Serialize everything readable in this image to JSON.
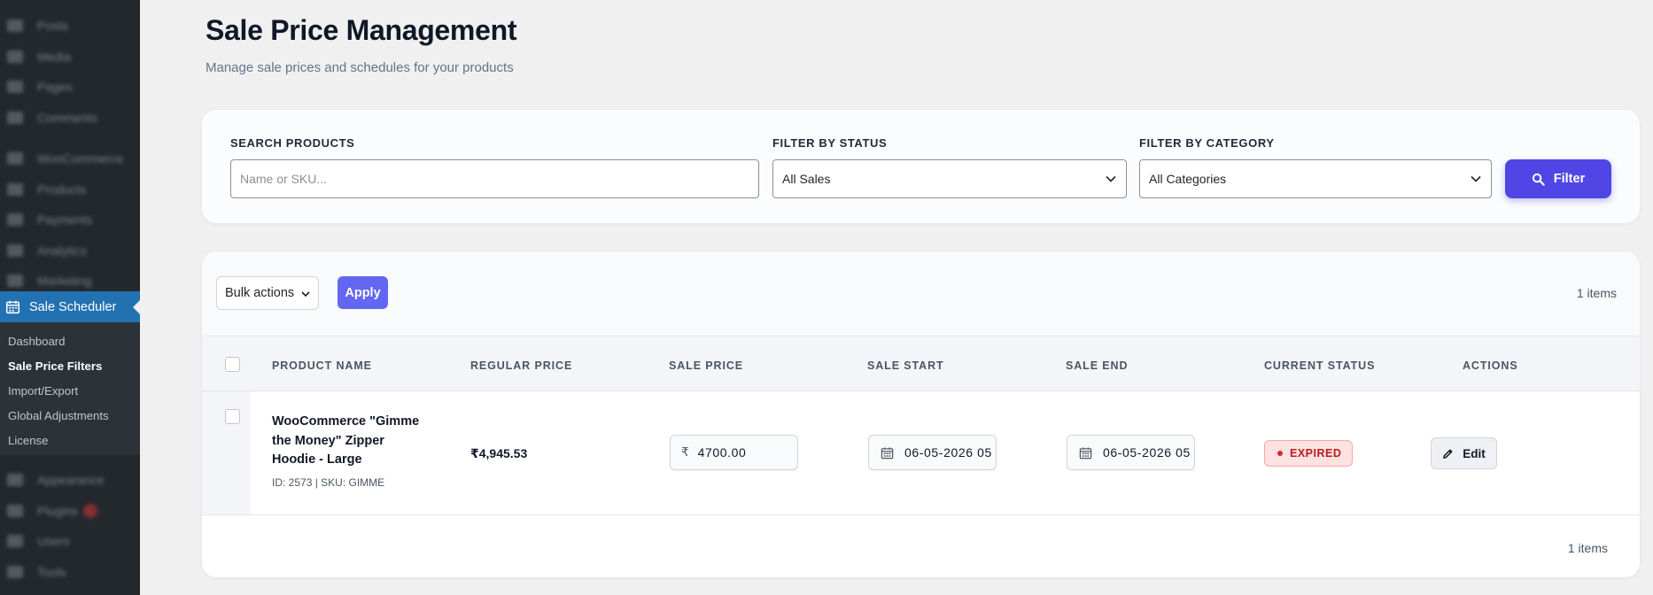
{
  "sidebar": {
    "active_label": "Sale Scheduler",
    "submenu": [
      {
        "label": "Dashboard",
        "current": false
      },
      {
        "label": "Sale Price Filters",
        "current": true
      },
      {
        "label": "Import/Export",
        "current": false
      },
      {
        "label": "Global Adjustments",
        "current": false
      },
      {
        "label": "License",
        "current": false
      }
    ]
  },
  "page": {
    "title": "Sale Price Management",
    "subtitle": "Manage sale prices and schedules for your products"
  },
  "filters": {
    "search_label": "SEARCH PRODUCTS",
    "search_placeholder": "Name or SKU...",
    "status_label": "FILTER BY STATUS",
    "status_value": "All Sales",
    "category_label": "FILTER BY CATEGORY",
    "category_value": "All Categories",
    "filter_button": "Filter"
  },
  "toolbar": {
    "bulk_actions": "Bulk actions",
    "apply": "Apply",
    "items_count": "1 items"
  },
  "table": {
    "columns": [
      "PRODUCT NAME",
      "REGULAR PRICE",
      "SALE PRICE",
      "SALE START",
      "SALE END",
      "CURRENT STATUS",
      "ACTIONS"
    ],
    "rows": [
      {
        "product_name": "WooCommerce \"Gimme the Money\" Zipper Hoodie - Large",
        "meta": "ID: 2573 | SKU: GIMME",
        "regular_price": "₹4,945.53",
        "currency_symbol": "₹",
        "sale_price": "4700.00",
        "sale_start": "06-05-2026 05",
        "sale_end": "06-05-2026 05",
        "status": "EXPIRED",
        "action": "Edit"
      }
    ]
  },
  "footer": {
    "items_count": "1 items"
  },
  "colors": {
    "accent": "#4f46e5",
    "apply": "#6366f1",
    "sidebar": "#23282d",
    "sidebar_active": "#2271b1",
    "expired_bg": "#fee2e2",
    "expired_text": "#b91c1c"
  }
}
